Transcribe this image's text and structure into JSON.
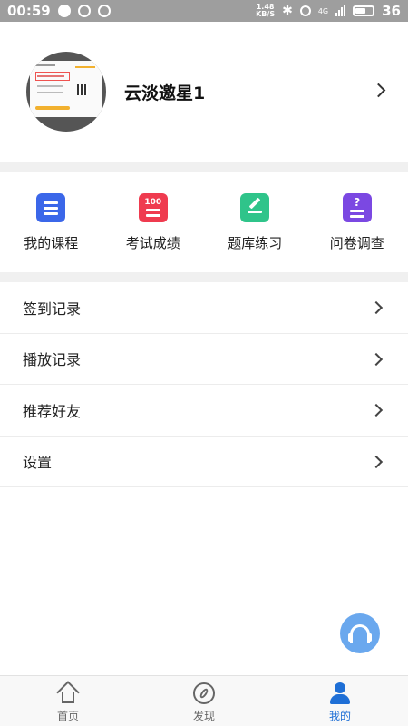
{
  "status_bar": {
    "time": "00:59",
    "net_speed_value": "1.48",
    "net_speed_unit": "KB/S",
    "signal": "4G",
    "battery": "36"
  },
  "profile": {
    "username": "云淡邀星1"
  },
  "quick_grid": [
    {
      "label": "我的课程",
      "icon": "course-list-icon",
      "color": "#3b67e9"
    },
    {
      "label": "考试成绩",
      "icon": "exam-score-icon",
      "color": "#ef3b4f",
      "icon_text": "100"
    },
    {
      "label": "题库练习",
      "icon": "question-bank-edit-icon",
      "color": "#2fc48a"
    },
    {
      "label": "问卷调查",
      "icon": "survey-question-icon",
      "color": "#7b48e2",
      "icon_text": "?"
    }
  ],
  "menu": [
    {
      "label": "签到记录"
    },
    {
      "label": "播放记录"
    },
    {
      "label": "推荐好友"
    },
    {
      "label": "设置"
    }
  ],
  "bottom_nav": [
    {
      "label": "首页",
      "icon": "home-icon",
      "active": false
    },
    {
      "label": "发现",
      "icon": "compass-icon",
      "active": false
    },
    {
      "label": "我的",
      "icon": "user-icon",
      "active": true
    }
  ],
  "colors": {
    "accent": "#1f6fd6",
    "fab": "#6aa8ee"
  }
}
